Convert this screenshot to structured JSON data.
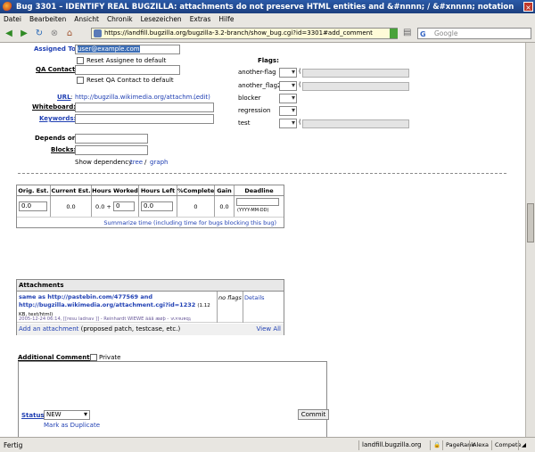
{
  "window": {
    "title": "Bug 3301 – IDENTIFY REAL BUGZILLA: attachments do not preserve HTML entities and &#nnnn; / &#xnnnn; notation"
  },
  "menu": [
    "Datei",
    "Bearbeiten",
    "Ansicht",
    "Chronik",
    "Lesezeichen",
    "Extras",
    "Hilfe"
  ],
  "nav": {
    "url": "https://landfill.bugzilla.org/bugzilla-3.2-branch/show_bug.cgi?id=3301#add_comment",
    "search_placeholder": "Google"
  },
  "form": {
    "assigned_to_label": "Assigned To:",
    "assigned_to_value": "user@example.com",
    "reset_assignee": "Reset Assignee to default",
    "qa_contact_label": "QA Contact:",
    "reset_qa": "Reset QA Contact to default",
    "url_label": "URL",
    "url_value": "http://bugzilla.wikimedia.org/attachm…",
    "url_edit": "(edit)",
    "whiteboard_label": "Whiteboard:",
    "keywords_label": "Keywords:",
    "depends_label": "Depends on:",
    "blocks_label": "Blocks:",
    "show_dependency": "Show dependency",
    "tree": "tree",
    "slash": "/",
    "graph": "graph"
  },
  "flags": {
    "title": "Flags:",
    "items": [
      "another-flag",
      "another_flag2",
      "blocker",
      "regression",
      "test"
    ]
  },
  "time": {
    "headers": [
      "Orig. Est.",
      "Current Est.",
      "Hours Worked",
      "Hours Left",
      "%Complete",
      "Gain",
      "Deadline"
    ],
    "orig_est": "0.0",
    "current_est": "0.0",
    "hours_worked": "0.0 +",
    "hours_worked_add": "0",
    "hours_left": "0.0",
    "complete": "0",
    "gain": "0.0",
    "deadline_hint": "(YYYY-MM-DD)",
    "summarize": "Summarize time (including time for bugs blocking this bug)"
  },
  "attachments": {
    "title": "Attachments",
    "item_title": "same as http://pastebin.com/477569 and http://bugzilla.wikimedia.org/attachment.cgi?id=1232",
    "item_meta": "(1.12 KB, text/html)",
    "item_date": "2005-12-24 06:14, [[resu ladnav ]] - Reinhardt WIEWE ääå æøþ - ℩ʌ×ɐɹɐqʇ",
    "flags": "no flags",
    "details": "Details",
    "add": "Add an attachment",
    "add_desc": "(proposed patch, testcase, etc.)",
    "view_all": "View All"
  },
  "comment": {
    "label": "Additional Comments",
    "colon": ":",
    "private": "Private"
  },
  "status": {
    "label": "Status",
    "value": "NEW",
    "mark_dup": "Mark as Duplicate",
    "commit": "Commit"
  },
  "statusbar": {
    "left": "Fertig",
    "host": "landfill.bugzilla.org",
    "pagerank": "PageRank",
    "alexa": "Alexa",
    "compete": "Compete"
  }
}
